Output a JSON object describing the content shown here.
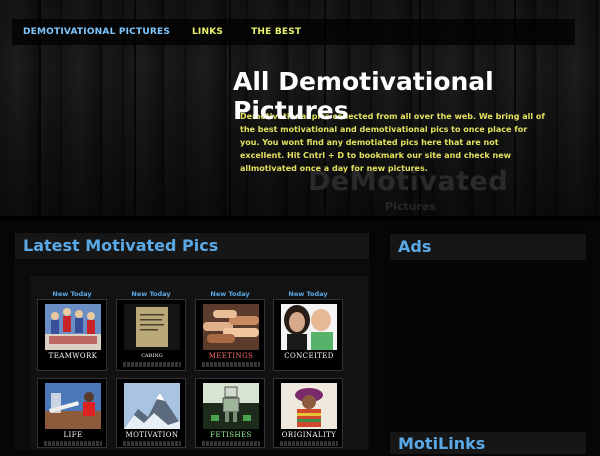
{
  "nav": {
    "items": [
      {
        "label": "DEMOTIVATIONAL PICTURES"
      },
      {
        "label": "LINKS"
      },
      {
        "label": "THE BEST"
      }
    ]
  },
  "header": {
    "title": "All Demotivational Pictures",
    "intro": "Demotivational pics collected from all over the web. We bring all of the best motivational and demotivational pics to once place for you. You wont find any demotiated pics here that are not excellent. Hit Cntrl + D to bookmark our site and check new allmotivated once a day for new pictures.",
    "watermark": "DeMotivated",
    "watermark_sub": "Pictures"
  },
  "sections": {
    "latest_title": "Latest Motivated Pics",
    "ads_title": "Ads",
    "motilinks_title": "MotiLinks"
  },
  "gallery": {
    "badge": "New Today",
    "row1": [
      {
        "caption": "TEAMWORK",
        "icon": "cheerleaders-photo"
      },
      {
        "caption": "CARING",
        "icon": "note-photo"
      },
      {
        "caption": "MEETINGS",
        "icon": "hands-photo"
      },
      {
        "caption": "CONCEITED",
        "icon": "children-photo"
      }
    ],
    "row2": [
      {
        "caption": "LIFE",
        "icon": "hurdle-photo"
      },
      {
        "caption": "MOTIVATION",
        "icon": "mountain-photo"
      },
      {
        "caption": "FETISHES",
        "icon": "robot-photo"
      },
      {
        "caption": "ORIGINALITY",
        "icon": "costume-photo"
      }
    ]
  },
  "colors": {
    "accent_blue": "#5aa9e6",
    "nav_yellow": "#e9f26a",
    "intro_yellow": "#e3e25f"
  }
}
